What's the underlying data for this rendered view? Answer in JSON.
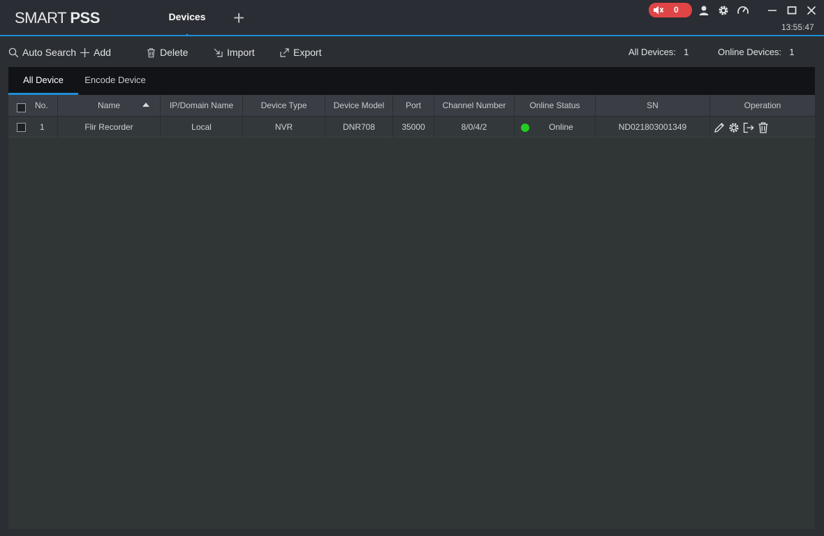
{
  "app": {
    "logo_light": "SMART",
    "logo_bold": "PSS",
    "tab_label": "Devices",
    "tab_add_label": "+",
    "alarm_count": "0",
    "clock": "13:55:47",
    "accent_color": "#1e8fd6",
    "alarm_color": "#e04545"
  },
  "toolbar": {
    "auto_search": "Auto Search",
    "add": "Add",
    "delete": "Delete",
    "import": "Import",
    "export": "Export",
    "all_devices_label": "All Devices:",
    "all_devices_count": "1",
    "online_devices_label": "Online Devices:",
    "online_devices_count": "1"
  },
  "subtabs": {
    "all_device": "All Device",
    "encode_device": "Encode Device"
  },
  "table": {
    "columns": [
      "No.",
      "Name",
      "IP/Domain Name",
      "Device Type",
      "Device Model",
      "Port",
      "Channel Number",
      "Online Status",
      "SN",
      "Operation"
    ],
    "rows": [
      {
        "no": "1",
        "name": "Flir Recorder",
        "ip": "Local",
        "type": "NVR",
        "model": "DNR708",
        "port": "35000",
        "channels": "8/0/4/2",
        "status": "Online",
        "status_color": "#22cc22",
        "sn": "ND021803001349"
      }
    ]
  }
}
